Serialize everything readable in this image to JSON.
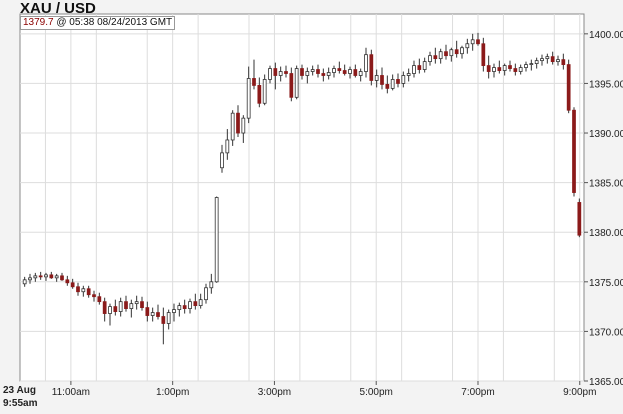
{
  "header": {
    "title": "XAU / USD",
    "last_price": "1379.7",
    "quote_time": "@ 05:38  08/24/2013 GMT"
  },
  "colors": {
    "up_candle": "#3a4a2a",
    "down_candle": "#8b1a1a",
    "wick": "#333333",
    "grid": "#dddddd",
    "plot_bg": "#ffffff",
    "page_bg": "#f3f3f3"
  },
  "chart_data": {
    "type": "candlestick",
    "title": "XAU / USD",
    "xlabel": "",
    "ylabel": "",
    "ylim": [
      1365,
      1402
    ],
    "xlim": [
      "10:00",
      "21:05"
    ],
    "grid": true,
    "y_axis_side": "right",
    "y_ticks": [
      "1365.00",
      "1370.00",
      "1375.00",
      "1380.00",
      "1385.00",
      "1390.00",
      "1395.00",
      "1400.00"
    ],
    "x_ticks": [
      {
        "t": 60,
        "label": "11:00am"
      },
      {
        "t": 180,
        "label": "1:00pm"
      },
      {
        "t": 300,
        "label": "3:00pm"
      },
      {
        "t": 420,
        "label": "5:00pm"
      },
      {
        "t": 540,
        "label": "7:00pm"
      },
      {
        "t": 660,
        "label": "9:00pm"
      }
    ],
    "date_label": [
      "23 Aug",
      "9:55am"
    ],
    "candles": [
      [
        1374.8,
        1375.5,
        1374.5,
        1375.2
      ],
      [
        1375.2,
        1375.8,
        1374.8,
        1375.4
      ],
      [
        1375.4,
        1375.9,
        1375.0,
        1375.6
      ],
      [
        1375.6,
        1376.0,
        1375.2,
        1375.5
      ],
      [
        1375.5,
        1375.9,
        1375.1,
        1375.7
      ],
      [
        1375.7,
        1376.0,
        1375.3,
        1375.4
      ],
      [
        1375.4,
        1375.8,
        1375.0,
        1375.6
      ],
      [
        1375.6,
        1375.9,
        1375.1,
        1375.2
      ],
      [
        1375.2,
        1375.6,
        1374.6,
        1374.9
      ],
      [
        1374.9,
        1375.3,
        1374.3,
        1374.5
      ],
      [
        1374.5,
        1374.9,
        1373.6,
        1374.0
      ],
      [
        1374.0,
        1374.6,
        1373.5,
        1374.3
      ],
      [
        1374.3,
        1374.6,
        1373.4,
        1373.7
      ],
      [
        1373.7,
        1374.1,
        1373.0,
        1373.5
      ],
      [
        1373.5,
        1373.9,
        1372.7,
        1373.0
      ],
      [
        1373.0,
        1373.4,
        1371.0,
        1371.8
      ],
      [
        1371.8,
        1372.8,
        1370.6,
        1372.5
      ],
      [
        1372.5,
        1373.2,
        1371.6,
        1372.0
      ],
      [
        1372.0,
        1373.4,
        1371.5,
        1373.0
      ],
      [
        1373.0,
        1373.6,
        1372.0,
        1372.3
      ],
      [
        1372.3,
        1373.2,
        1371.4,
        1372.8
      ],
      [
        1372.8,
        1373.6,
        1372.2,
        1373.0
      ],
      [
        1373.0,
        1373.5,
        1372.1,
        1372.4
      ],
      [
        1372.4,
        1373.0,
        1371.0,
        1371.6
      ],
      [
        1371.6,
        1372.4,
        1371.0,
        1371.9
      ],
      [
        1371.9,
        1372.7,
        1371.2,
        1371.5
      ],
      [
        1371.5,
        1372.4,
        1368.7,
        1370.8
      ],
      [
        1370.8,
        1372.2,
        1370.2,
        1371.9
      ],
      [
        1371.9,
        1372.8,
        1371.0,
        1372.2
      ],
      [
        1372.2,
        1372.9,
        1371.5,
        1372.6
      ],
      [
        1372.6,
        1373.2,
        1371.8,
        1372.3
      ],
      [
        1372.3,
        1373.3,
        1371.8,
        1373.0
      ],
      [
        1373.0,
        1373.8,
        1372.2,
        1372.6
      ],
      [
        1372.6,
        1373.8,
        1372.3,
        1373.2
      ],
      [
        1373.2,
        1374.8,
        1372.8,
        1374.4
      ],
      [
        1374.4,
        1375.8,
        1373.8,
        1375.0
      ],
      [
        1375.0,
        1383.6,
        1374.9,
        1383.5
      ],
      [
        1386.5,
        1388.8,
        1386.0,
        1388.0
      ],
      [
        1388.0,
        1390.4,
        1387.3,
        1389.3
      ],
      [
        1389.3,
        1392.3,
        1388.7,
        1392.0
      ],
      [
        1392.0,
        1392.8,
        1389.6,
        1390.0
      ],
      [
        1390.0,
        1391.8,
        1389.0,
        1391.5
      ],
      [
        1391.5,
        1396.7,
        1391.0,
        1395.5
      ],
      [
        1395.5,
        1397.4,
        1394.4,
        1394.8
      ],
      [
        1394.8,
        1395.6,
        1392.6,
        1393.0
      ],
      [
        1393.0,
        1395.9,
        1392.8,
        1395.4
      ],
      [
        1395.4,
        1396.8,
        1395.0,
        1396.5
      ],
      [
        1396.5,
        1397.1,
        1394.4,
        1395.8
      ],
      [
        1395.8,
        1396.7,
        1395.2,
        1396.2
      ],
      [
        1396.2,
        1396.8,
        1395.6,
        1396.0
      ],
      [
        1396.0,
        1396.6,
        1393.2,
        1393.6
      ],
      [
        1393.6,
        1396.8,
        1393.4,
        1396.5
      ],
      [
        1396.5,
        1396.9,
        1395.4,
        1395.8
      ],
      [
        1395.8,
        1396.6,
        1395.0,
        1396.2
      ],
      [
        1396.2,
        1396.8,
        1395.8,
        1396.4
      ],
      [
        1396.4,
        1396.9,
        1395.6,
        1396.0
      ],
      [
        1396.0,
        1396.5,
        1395.2,
        1395.8
      ],
      [
        1395.8,
        1396.6,
        1395.4,
        1396.1
      ],
      [
        1396.1,
        1396.8,
        1395.6,
        1396.5
      ],
      [
        1396.5,
        1397.2,
        1396.0,
        1396.3
      ],
      [
        1396.3,
        1396.9,
        1395.8,
        1396.0
      ],
      [
        1396.0,
        1396.7,
        1395.5,
        1396.4
      ],
      [
        1396.4,
        1396.9,
        1395.6,
        1395.8
      ],
      [
        1395.8,
        1396.5,
        1395.2,
        1396.2
      ],
      [
        1396.2,
        1398.6,
        1395.6,
        1397.9
      ],
      [
        1397.9,
        1398.4,
        1394.8,
        1395.3
      ],
      [
        1395.3,
        1396.4,
        1394.6,
        1395.8
      ],
      [
        1395.8,
        1396.6,
        1394.4,
        1394.9
      ],
      [
        1394.9,
        1395.8,
        1394.0,
        1394.5
      ],
      [
        1394.5,
        1395.9,
        1394.3,
        1395.4
      ],
      [
        1395.4,
        1396.0,
        1394.6,
        1395.0
      ],
      [
        1395.0,
        1396.2,
        1394.6,
        1395.8
      ],
      [
        1395.8,
        1396.5,
        1395.2,
        1396.0
      ],
      [
        1396.0,
        1397.3,
        1395.6,
        1396.8
      ],
      [
        1396.8,
        1397.5,
        1396.0,
        1396.4
      ],
      [
        1396.4,
        1397.6,
        1396.1,
        1397.2
      ],
      [
        1397.2,
        1398.2,
        1396.8,
        1397.8
      ],
      [
        1397.8,
        1398.6,
        1397.0,
        1397.5
      ],
      [
        1397.5,
        1398.5,
        1397.0,
        1398.2
      ],
      [
        1398.2,
        1398.9,
        1397.4,
        1397.8
      ],
      [
        1397.8,
        1398.6,
        1397.2,
        1398.4
      ],
      [
        1398.4,
        1399.3,
        1397.6,
        1398.0
      ],
      [
        1398.0,
        1398.8,
        1397.5,
        1398.6
      ],
      [
        1398.6,
        1399.5,
        1398.0,
        1399.0
      ],
      [
        1399.0,
        1400.0,
        1398.3,
        1399.4
      ],
      [
        1399.4,
        1400.1,
        1398.8,
        1399.0
      ],
      [
        1399.0,
        1399.6,
        1396.2,
        1396.8
      ],
      [
        1396.8,
        1397.8,
        1395.5,
        1396.2
      ],
      [
        1396.2,
        1397.0,
        1395.6,
        1396.6
      ],
      [
        1396.6,
        1397.3,
        1396.0,
        1396.3
      ],
      [
        1396.3,
        1397.0,
        1395.8,
        1396.8
      ],
      [
        1396.8,
        1397.3,
        1396.2,
        1396.5
      ],
      [
        1396.5,
        1397.0,
        1395.8,
        1396.2
      ],
      [
        1396.2,
        1396.9,
        1395.9,
        1396.6
      ],
      [
        1396.6,
        1397.2,
        1396.2,
        1396.9
      ],
      [
        1396.9,
        1397.4,
        1396.3,
        1397.0
      ],
      [
        1397.0,
        1397.6,
        1396.5,
        1397.3
      ],
      [
        1397.3,
        1397.9,
        1396.8,
        1397.5
      ],
      [
        1397.5,
        1398.0,
        1397.0,
        1397.7
      ],
      [
        1397.7,
        1398.2,
        1396.9,
        1397.2
      ],
      [
        1397.2,
        1397.8,
        1396.8,
        1397.4
      ],
      [
        1397.4,
        1398.0,
        1396.4,
        1396.9
      ],
      [
        1396.9,
        1397.4,
        1392.0,
        1392.3
      ],
      [
        1392.3,
        1392.6,
        1383.6,
        1384.0
      ],
      [
        1383.0,
        1383.4,
        1379.5,
        1379.7
      ]
    ]
  }
}
